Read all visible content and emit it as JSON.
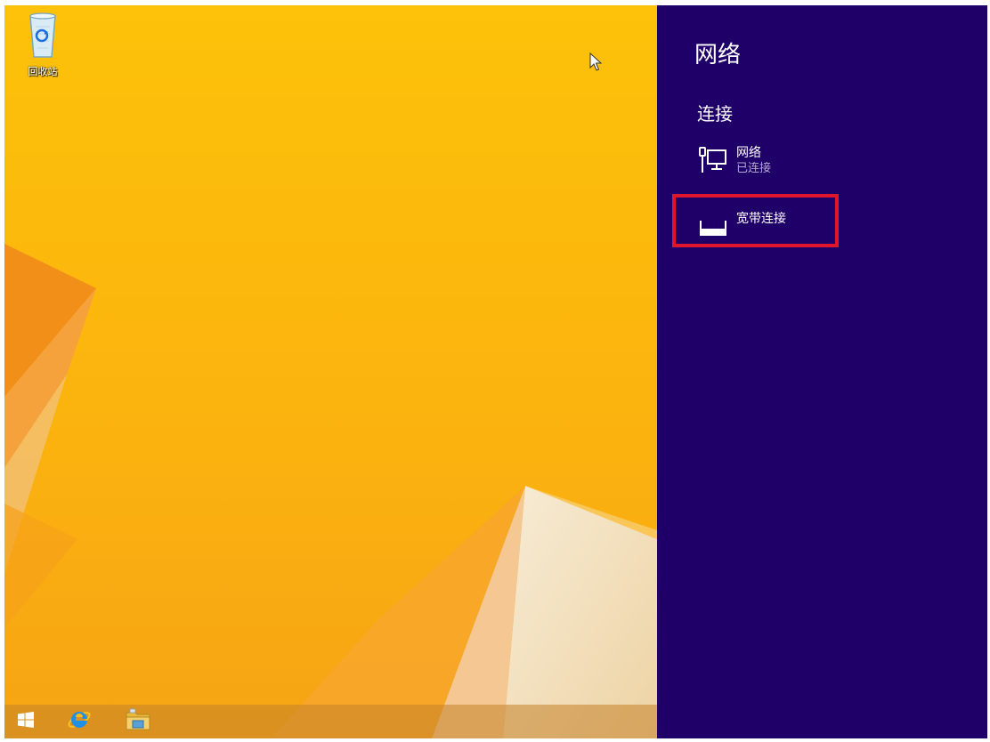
{
  "desktop": {
    "icons": [
      {
        "label": "回收站",
        "icon": "recycle-bin-icon"
      }
    ],
    "colors": {
      "wallpaper": "#fdbd0b",
      "facet_orange": "#f29a12",
      "facet_cream": "#f3e4c8"
    }
  },
  "taskbar": {
    "items": [
      {
        "icon": "windows-start-icon"
      },
      {
        "icon": "internet-explorer-icon"
      },
      {
        "icon": "file-explorer-icon"
      }
    ]
  },
  "network_panel": {
    "title": "网络",
    "section_title": "连接",
    "connections": [
      {
        "name": "网络",
        "status": "已连接",
        "icon": "wired-network-icon"
      },
      {
        "name": "宽带连接",
        "status": "",
        "icon": "broadband-modem-icon",
        "highlighted": true
      }
    ],
    "colors": {
      "background": "#1f0068",
      "highlight_border": "#e0152b",
      "status_text": "#b1a8cf"
    }
  }
}
